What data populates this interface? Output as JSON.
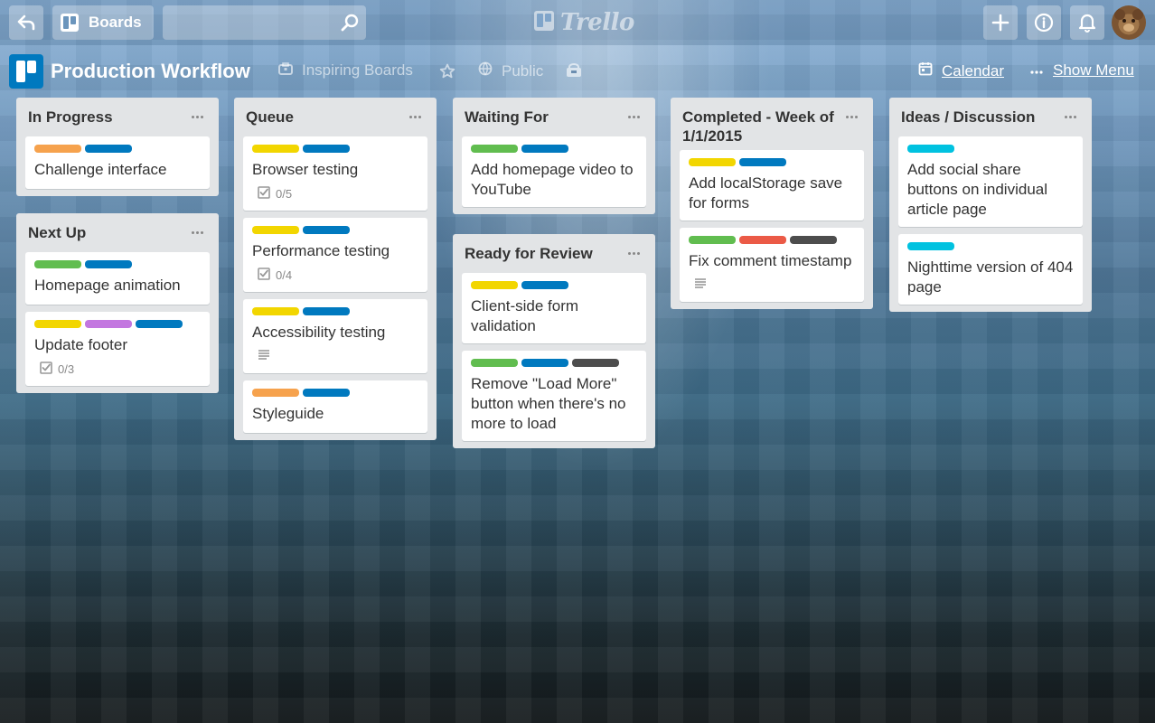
{
  "header": {
    "boards_label": "Boards",
    "search_placeholder": "",
    "logo_text": "Trello"
  },
  "board": {
    "title": "Production Workflow",
    "team": "Inspiring Boards",
    "visibility": "Public",
    "calendar_label": "Calendar",
    "menu_label": "Show Menu"
  },
  "label_colors": {
    "orange": "#f6a24d",
    "blue": "#0079bf",
    "yellow": "#f2d600",
    "green": "#61bd4f",
    "purple": "#c377e0",
    "red": "#eb5a46",
    "black": "#4d4d4d",
    "sky": "#00c2e0"
  },
  "lists": [
    {
      "title": "In Progress",
      "cards": [
        {
          "title": "Challenge interface",
          "labels": [
            "orange",
            "blue"
          ]
        }
      ]
    },
    {
      "title": "Next Up",
      "cards": [
        {
          "title": "Homepage animation",
          "labels": [
            "green",
            "blue"
          ]
        },
        {
          "title": "Update footer",
          "labels": [
            "yellow",
            "purple",
            "blue"
          ],
          "checklist": "0/3"
        }
      ]
    },
    {
      "title": "Queue",
      "cards": [
        {
          "title": "Browser testing",
          "labels": [
            "yellow",
            "blue"
          ],
          "checklist": "0/5"
        },
        {
          "title": "Performance testing",
          "labels": [
            "yellow",
            "blue"
          ],
          "checklist": "0/4"
        },
        {
          "title": "Accessibility testing",
          "labels": [
            "yellow",
            "blue"
          ],
          "description": true
        },
        {
          "title": "Styleguide",
          "labels": [
            "orange",
            "blue"
          ]
        }
      ]
    },
    {
      "title": "Waiting For",
      "cards": [
        {
          "title": "Add homepage video to YouTube",
          "labels": [
            "green",
            "blue"
          ]
        }
      ]
    },
    {
      "title": "Ready for Review",
      "cards": [
        {
          "title": "Client-side form validation",
          "labels": [
            "yellow",
            "blue"
          ]
        },
        {
          "title": "Remove \"Load More\" button when there's no more to load",
          "labels": [
            "green",
            "blue",
            "black"
          ]
        }
      ]
    },
    {
      "title": "Completed - Week of 1/1/2015",
      "cards": [
        {
          "title": "Add localStorage save for forms",
          "labels": [
            "yellow",
            "blue"
          ]
        },
        {
          "title": "Fix comment timestamp",
          "labels": [
            "green",
            "red",
            "black"
          ],
          "description": true
        }
      ]
    },
    {
      "title": "Ideas / Discussion",
      "cards": [
        {
          "title": "Add social share buttons on individual article page",
          "labels": [
            "sky"
          ]
        },
        {
          "title": "Nighttime version of 404 page",
          "labels": [
            "sky"
          ]
        }
      ]
    }
  ]
}
